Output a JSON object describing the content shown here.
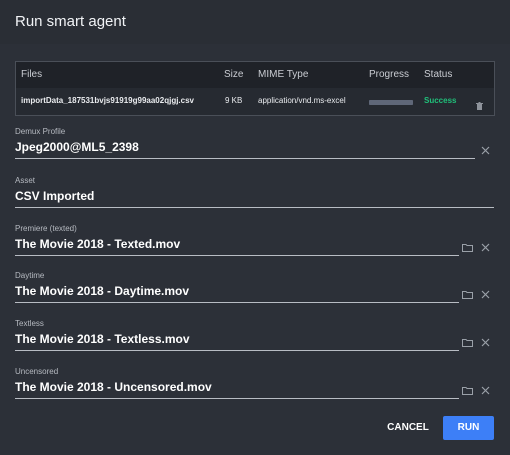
{
  "dialog": {
    "title": "Run smart agent"
  },
  "files_table": {
    "headers": [
      "Files",
      "Size",
      "MIME Type",
      "Progress",
      "Status"
    ],
    "rows": [
      {
        "name": "importData_187531bvjs91919g99aa02qjgj.csv",
        "size": "9 KB",
        "mime": "application/vnd.ms-excel",
        "progress": 1.0,
        "status": "Success"
      }
    ]
  },
  "fields": [
    {
      "label": "Demux Profile",
      "value": "Jpeg2000@ML5_2398"
    },
    {
      "label": "Asset",
      "value": "CSV Imported"
    },
    {
      "label": "Premiere (texted)",
      "value": "The Movie 2018 - Texted.mov"
    },
    {
      "label": "Daytime",
      "value": "The Movie 2018 - Daytime.mov"
    },
    {
      "label": "Textless",
      "value": "The Movie 2018 - Textless.mov"
    },
    {
      "label": "Uncensored",
      "value": "The Movie 2018 - Uncensored.mov"
    }
  ],
  "actions": {
    "cancel": "CANCEL",
    "run": "RUN"
  },
  "icons": {
    "folder": "folder-icon",
    "clear": "close-icon",
    "delete": "trash-icon"
  },
  "colors": {
    "accent": "#3d7ff7",
    "success": "#20c07a"
  }
}
